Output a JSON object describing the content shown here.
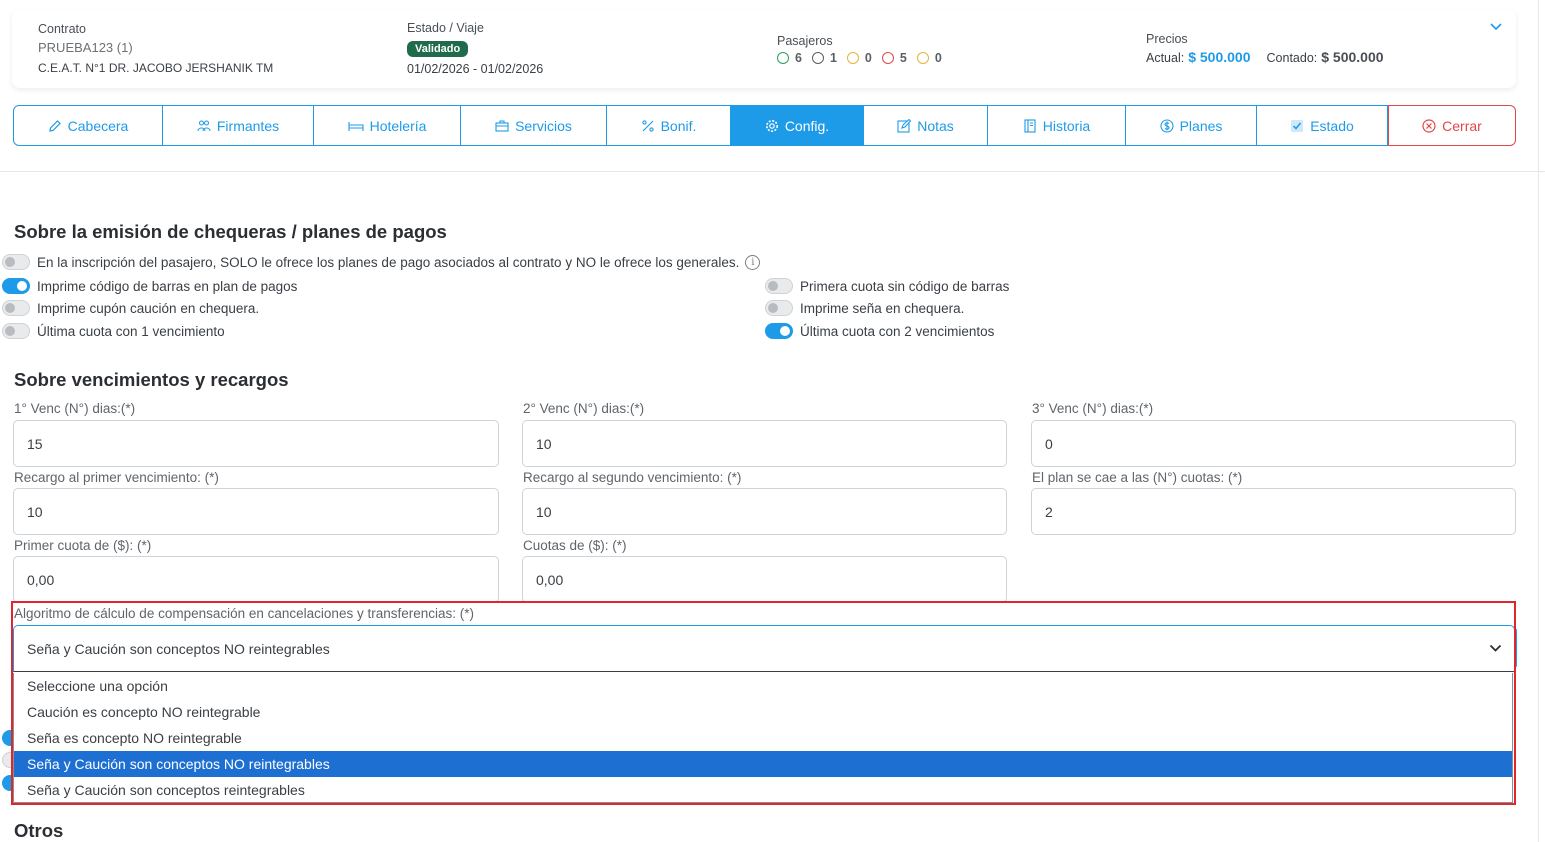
{
  "header": {
    "contract_label": "Contrato",
    "contract_name": "PRUEBA123 (1)",
    "contract_school": "C.E.A.T. N°1 DR. JACOBO JERSHANIK TM",
    "status_label": "Estado / Viaje",
    "status_badge": "Validado",
    "status_dates": "01/02/2026 - 01/02/2026",
    "passengers_label": "Pasajeros",
    "passengers": [
      {
        "icon": "check-circle-icon",
        "count": "6",
        "color": "#2f9d5b"
      },
      {
        "icon": "user-x-icon",
        "count": "1",
        "color": "#5a5f65"
      },
      {
        "icon": "clock-icon",
        "count": "0",
        "color": "#e8b23a"
      },
      {
        "icon": "ban-icon",
        "count": "5",
        "color": "#e04848"
      },
      {
        "icon": "alert-icon",
        "count": "0",
        "color": "#e8b23a"
      }
    ],
    "prices_label": "Precios",
    "actual_label": "Actual:",
    "actual_value": "$ 500.000",
    "contado_label": "Contado:",
    "contado_value": "$ 500.000"
  },
  "tabs": [
    {
      "label": "Cabecera",
      "icon": "pencil-icon"
    },
    {
      "label": "Firmantes",
      "icon": "users-icon"
    },
    {
      "label": "Hotelería",
      "icon": "bed-icon"
    },
    {
      "label": "Servicios",
      "icon": "briefcase-icon"
    },
    {
      "label": "Bonif.",
      "icon": "percent-icon"
    },
    {
      "label": "Config.",
      "icon": "gear-icon"
    },
    {
      "label": "Notas",
      "icon": "edit-icon"
    },
    {
      "label": "Historia",
      "icon": "book-icon"
    },
    {
      "label": "Planes",
      "icon": "dollar-icon"
    },
    {
      "label": "Estado",
      "icon": "checkbox-icon"
    },
    {
      "label": "Cerrar",
      "icon": "close-circle-icon"
    }
  ],
  "section1": {
    "title": "Sobre la emisión de chequeras / planes de pagos",
    "toggle_full": "En la inscripción del pasajero, SOLO le ofrece los planes de pago asociados al contrato y NO le ofrece los generales.",
    "left": [
      {
        "label": "Imprime código de barras en plan de pagos",
        "on": true
      },
      {
        "label": "Imprime cupón caución en chequera.",
        "on": false
      },
      {
        "label": "Última cuota con 1 vencimiento",
        "on": false
      }
    ],
    "right": [
      {
        "label": "Primera cuota sin código de barras",
        "on": false
      },
      {
        "label": "Imprime seña en chequera.",
        "on": false
      },
      {
        "label": "Última cuota con 2 vencimientos",
        "on": true
      }
    ]
  },
  "section2": {
    "title": "Sobre vencimientos y recargos",
    "venc1_label": "1° Venc (N°) dias:(*)",
    "venc1_value": "15",
    "venc2_label": "2° Venc (N°) dias:(*)",
    "venc2_value": "10",
    "venc3_label": "3° Venc (N°) dias:(*)",
    "venc3_value": "0",
    "recargo1_label": "Recargo al primer vencimiento: (*)",
    "recargo1_value": "10",
    "recargo2_label": "Recargo al segundo vencimiento: (*)",
    "recargo2_value": "10",
    "plan_cae_label": "El plan se cae a las (N°) cuotas: (*)",
    "plan_cae_value": "2",
    "primer_cuota_label": "Primer cuota de ($): (*)",
    "primer_cuota_value": "0,00",
    "cuotas_label": "Cuotas de ($): (*)",
    "cuotas_value": "0,00",
    "algoritmo_label": "Algoritmo de cálculo de compensación en cancelaciones y transferencias: (*)",
    "algoritmo_value": "Seña y Caución son conceptos NO reintegrables",
    "algoritmo_options": [
      "Seleccione una opción",
      "Caución es concepto NO reintegrable",
      "Seña es concepto NO reintegrable",
      "Seña y Caución son conceptos NO reintegrables",
      "Seña y Caución son conceptos reintegrables"
    ],
    "selected_index": 3
  },
  "section3": {
    "title": "Otros"
  }
}
